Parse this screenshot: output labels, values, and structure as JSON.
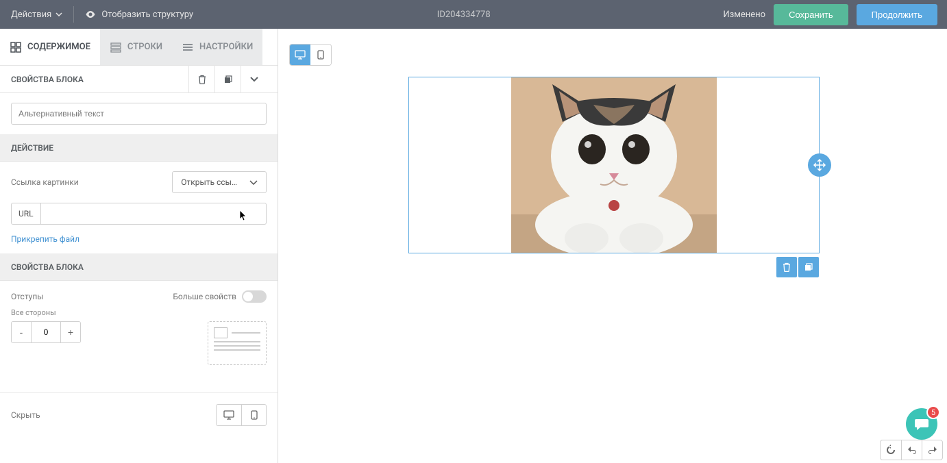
{
  "topbar": {
    "actions": "Действия",
    "show_structure": "Отобразить структуру",
    "doc_id": "ID204334778",
    "status": "Изменено",
    "save": "Сохранить",
    "continue": "Продолжить"
  },
  "tabs": {
    "content": "СОДЕРЖИМОЕ",
    "rows": "СТРОКИ",
    "settings": "НАСТРОЙКИ"
  },
  "panel": {
    "block_props": "СВОЙСТВА БЛОКА",
    "alt_placeholder": "Альтернативный текст",
    "action_header": "ДЕЙСТВИЕ",
    "image_link": "Ссылка картинки",
    "open_link": "Открыть ссы…",
    "url_label": "URL",
    "url_value": "",
    "attach_file": "Прикрепить файл",
    "block_props2": "СВОЙСТВА БЛОКА",
    "padding": "Отступы",
    "more_props": "Больше свойств",
    "all_sides": "Все стороны",
    "padding_value": "0",
    "hide": "Скрыть"
  },
  "chat": {
    "count": "5"
  }
}
